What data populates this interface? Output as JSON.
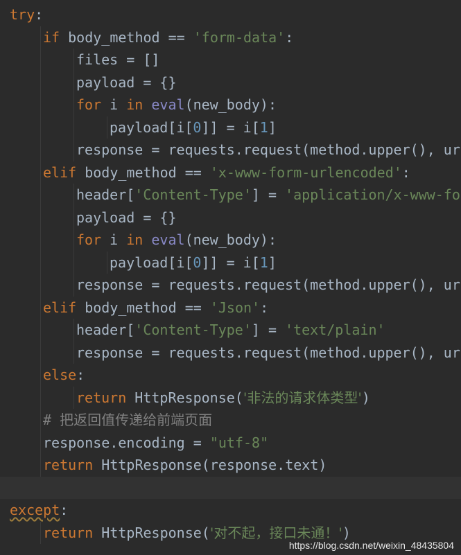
{
  "editor": {
    "lines": [
      {
        "indent": 0,
        "tokens": [
          [
            "kw",
            "try"
          ],
          [
            "p",
            ":"
          ]
        ]
      },
      {
        "indent": 1,
        "tokens": [
          [
            "kw",
            "if"
          ],
          [
            "p",
            " body_method == "
          ],
          [
            "str",
            "'form-data'"
          ],
          [
            "p",
            ":"
          ]
        ]
      },
      {
        "indent": 2,
        "tokens": [
          [
            "p",
            "files = []"
          ]
        ]
      },
      {
        "indent": 2,
        "tokens": [
          [
            "p",
            "payload = {}"
          ]
        ]
      },
      {
        "indent": 2,
        "tokens": [
          [
            "kw",
            "for"
          ],
          [
            "p",
            " i "
          ],
          [
            "kw",
            "in"
          ],
          [
            "p",
            " "
          ],
          [
            "bi",
            "eval"
          ],
          [
            "p",
            "(new_body):"
          ]
        ]
      },
      {
        "indent": 3,
        "tokens": [
          [
            "p",
            "payload[i["
          ],
          [
            "num",
            "0"
          ],
          [
            "p",
            "]] = i["
          ],
          [
            "num",
            "1"
          ],
          [
            "p",
            "]"
          ]
        ]
      },
      {
        "indent": 2,
        "tokens": [
          [
            "p",
            "response = requests.request(method.upper(), ur"
          ]
        ]
      },
      {
        "indent": 1,
        "tokens": [
          [
            "kw",
            "elif"
          ],
          [
            "p",
            " body_method == "
          ],
          [
            "str",
            "'x-www-form-urlencoded'"
          ],
          [
            "p",
            ":"
          ]
        ]
      },
      {
        "indent": 2,
        "tokens": [
          [
            "p",
            "header["
          ],
          [
            "str",
            "'Content-Type'"
          ],
          [
            "p",
            "] = "
          ],
          [
            "str",
            "'application/x-www-for"
          ]
        ]
      },
      {
        "indent": 2,
        "tokens": [
          [
            "p",
            "payload = {}"
          ]
        ]
      },
      {
        "indent": 2,
        "tokens": [
          [
            "kw",
            "for"
          ],
          [
            "p",
            " i "
          ],
          [
            "kw",
            "in"
          ],
          [
            "p",
            " "
          ],
          [
            "bi",
            "eval"
          ],
          [
            "p",
            "(new_body):"
          ]
        ]
      },
      {
        "indent": 3,
        "tokens": [
          [
            "p",
            "payload[i["
          ],
          [
            "num",
            "0"
          ],
          [
            "p",
            "]] = i["
          ],
          [
            "num",
            "1"
          ],
          [
            "p",
            "]"
          ]
        ]
      },
      {
        "indent": 2,
        "tokens": [
          [
            "p",
            "response = requests.request(method.upper(), ur"
          ]
        ]
      },
      {
        "indent": 1,
        "tokens": [
          [
            "kw",
            "elif"
          ],
          [
            "p",
            " body_method == "
          ],
          [
            "str",
            "'Json'"
          ],
          [
            "p",
            ":"
          ]
        ]
      },
      {
        "indent": 2,
        "tokens": [
          [
            "p",
            "header["
          ],
          [
            "str",
            "'Content-Type'"
          ],
          [
            "p",
            "] = "
          ],
          [
            "str",
            "'text/plain'"
          ]
        ]
      },
      {
        "indent": 2,
        "tokens": [
          [
            "p",
            "response = requests.request(method.upper(), ur"
          ]
        ]
      },
      {
        "indent": 1,
        "tokens": [
          [
            "kw",
            "else"
          ],
          [
            "p",
            ":"
          ]
        ]
      },
      {
        "indent": 2,
        "tokens": [
          [
            "kw",
            "return"
          ],
          [
            "p",
            " HttpResponse("
          ],
          [
            "strcjk",
            "'非法的请求体类型'"
          ],
          [
            "p",
            ")"
          ]
        ]
      },
      {
        "indent": 1,
        "tokens": [
          [
            "cmt",
            "# "
          ],
          [
            "cmtcjk",
            "把返回值传递给前端页面"
          ]
        ]
      },
      {
        "indent": 1,
        "tokens": [
          [
            "p",
            "response.encoding = "
          ],
          [
            "str",
            "\"utf-8\""
          ]
        ]
      },
      {
        "indent": 1,
        "tokens": [
          [
            "kw",
            "return"
          ],
          [
            "p",
            " HttpResponse(response.text)"
          ]
        ]
      },
      {
        "indent": 0,
        "tokens": [],
        "current": true
      },
      {
        "indent": 0,
        "tokens": [
          [
            "kwtypo",
            "except"
          ],
          [
            "p",
            ":"
          ]
        ]
      },
      {
        "indent": 1,
        "tokens": [
          [
            "kw",
            "return"
          ],
          [
            "p",
            " HttpResponse("
          ],
          [
            "strcjk",
            "'对不起，接口未通！'"
          ],
          [
            "p",
            ")"
          ]
        ]
      }
    ]
  },
  "watermark": "https://blog.csdn.net/weixin_48435804",
  "colors": {
    "background": "#2b2b2b",
    "keyword": "#cc7832",
    "string": "#6a8759",
    "number": "#6897bb",
    "builtin": "#8888c6",
    "comment": "#808080",
    "plain": "#a9b7c6"
  }
}
